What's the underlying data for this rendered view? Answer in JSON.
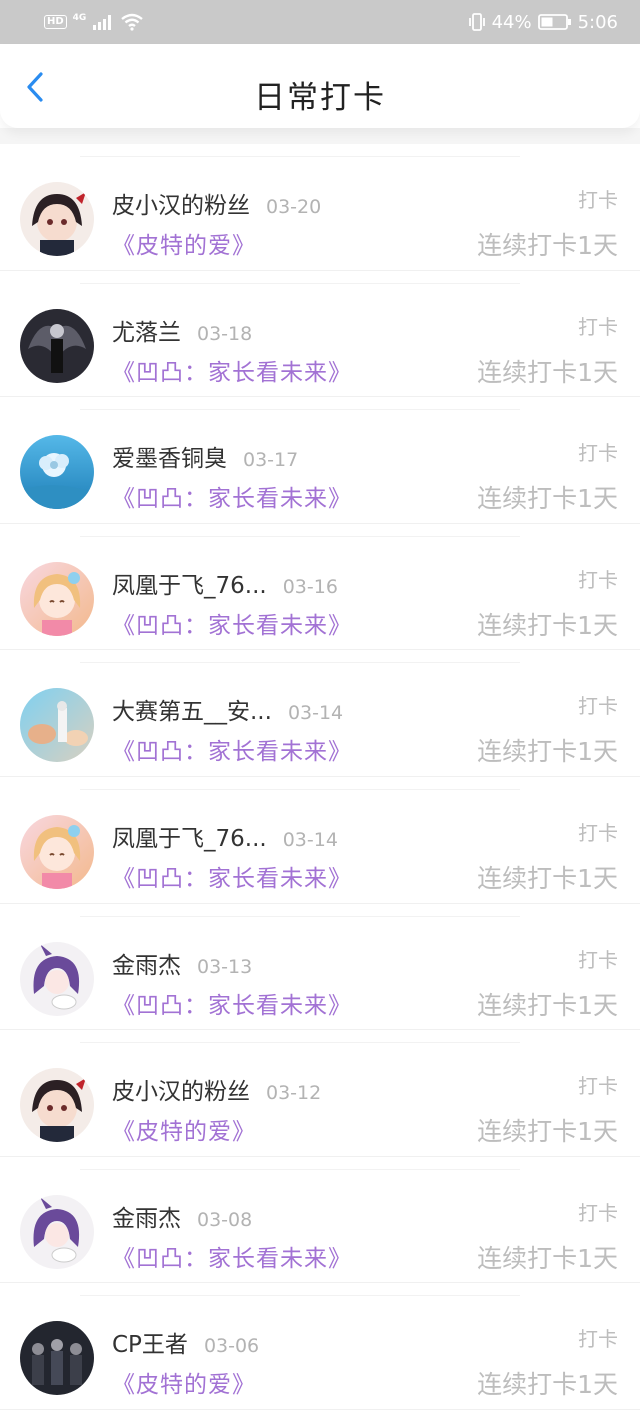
{
  "status_bar": {
    "hd": "HD",
    "network": "4G",
    "battery_percent": "44%",
    "time": "5:06"
  },
  "header": {
    "title": "日常打卡",
    "back_icon": "chevron-left-icon"
  },
  "colors": {
    "accent": "#2a8cf0",
    "book_title": "#a272d4",
    "muted": "#bdbdbd"
  },
  "entries": [
    {
      "name": "皮小汉的粉丝",
      "date": "03-20",
      "book": "《皮特的爱》",
      "label": "打卡",
      "streak": "连续打卡1天",
      "avatar": "anime-girl-dark-hair"
    },
    {
      "name": "尤落兰",
      "date": "03-18",
      "book": "《凹凸：家长看未来》",
      "label": "打卡",
      "streak": "连续打卡1天",
      "avatar": "dark-winged-figure"
    },
    {
      "name": "爱墨香铜臭",
      "date": "03-17",
      "book": "《凹凸：家长看未来》",
      "label": "打卡",
      "streak": "连续打卡1天",
      "avatar": "blue-sky-flower"
    },
    {
      "name": "凤凰于飞_76...",
      "date": "03-16",
      "book": "《凹凸：家长看未来》",
      "label": "打卡",
      "streak": "连续打卡1天",
      "avatar": "anime-girl-pink-blonde"
    },
    {
      "name": "大赛第五__安...",
      "date": "03-14",
      "book": "《凹凸：家长看未来》",
      "label": "打卡",
      "streak": "连续打卡1天",
      "avatar": "sky-landscape-figure"
    },
    {
      "name": "凤凰于飞_76...",
      "date": "03-14",
      "book": "《凹凸：家长看未来》",
      "label": "打卡",
      "streak": "连续打卡1天",
      "avatar": "anime-girl-pink-blonde"
    },
    {
      "name": "金雨杰",
      "date": "03-13",
      "book": "《凹凸：家长看未来》",
      "label": "打卡",
      "streak": "连续打卡1天",
      "avatar": "anime-purple-hair-chibi"
    },
    {
      "name": "皮小汉的粉丝",
      "date": "03-12",
      "book": "《皮特的爱》",
      "label": "打卡",
      "streak": "连续打卡1天",
      "avatar": "anime-girl-dark-hair"
    },
    {
      "name": "金雨杰",
      "date": "03-08",
      "book": "《凹凸：家长看未来》",
      "label": "打卡",
      "streak": "连续打卡1天",
      "avatar": "anime-purple-hair-chibi"
    },
    {
      "name": "CP王者",
      "date": "03-06",
      "book": "《皮特的爱》",
      "label": "打卡",
      "streak": "连续打卡1天",
      "avatar": "group-dark-figures"
    }
  ]
}
